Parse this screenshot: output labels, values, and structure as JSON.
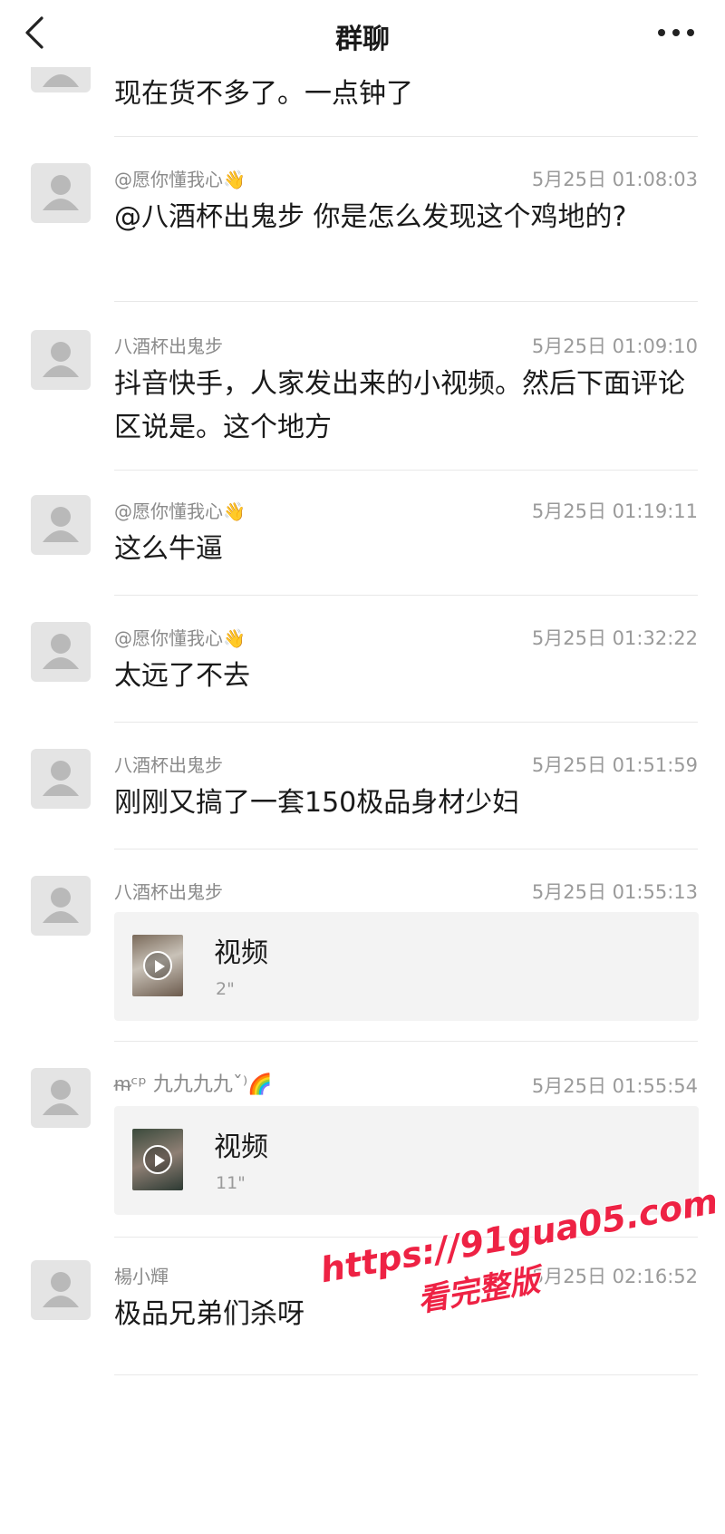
{
  "header": {
    "title": "群聊"
  },
  "messages": [
    {
      "id": "m0",
      "sender": "",
      "time": "",
      "text": "现在货不多了。一点钟了"
    },
    {
      "id": "m1",
      "sender": "@愿你懂我心👋",
      "time": "5月25日 01:08:03",
      "text": "@八酒杯出鬼步 你是怎么发现这个鸡地的?"
    },
    {
      "id": "m2",
      "sender": "八酒杯出鬼步",
      "time": "5月25日 01:09:10",
      "text": "抖音快手，人家发出来的小视频。然后下面评论区说是。这个地方"
    },
    {
      "id": "m3",
      "sender": "@愿你懂我心👋",
      "time": "5月25日 01:19:11",
      "text": "这么牛逼"
    },
    {
      "id": "m4",
      "sender": "@愿你懂我心👋",
      "time": "5月25日 01:32:22",
      "text": "太远了不去"
    },
    {
      "id": "m5",
      "sender": "八酒杯出鬼步",
      "time": "5月25日 01:51:59",
      "text": "刚刚又搞了一套150极品身材少妇"
    },
    {
      "id": "m6",
      "sender": "八酒杯出鬼步",
      "time": "5月25日 01:55:13",
      "video": {
        "label": "视频",
        "duration": "2\""
      }
    },
    {
      "id": "m7",
      "sender": "ᵯᶜᵖ 九九九九ˇ⁾🌈",
      "time": "5月25日 01:55:54",
      "video": {
        "label": "视频",
        "duration": "11\""
      }
    },
    {
      "id": "m8",
      "sender": "楊小輝",
      "time": "5月25日 02:16:52",
      "text": "极品兄弟们杀呀"
    }
  ],
  "watermark": {
    "url": "https://91gua05.com",
    "subtitle": "看完整版",
    "color": "#ee2244"
  },
  "icons": {
    "back": "chevron-left-icon",
    "more": "more-dots-icon",
    "avatar": "default-avatar-icon",
    "play": "play-icon"
  }
}
